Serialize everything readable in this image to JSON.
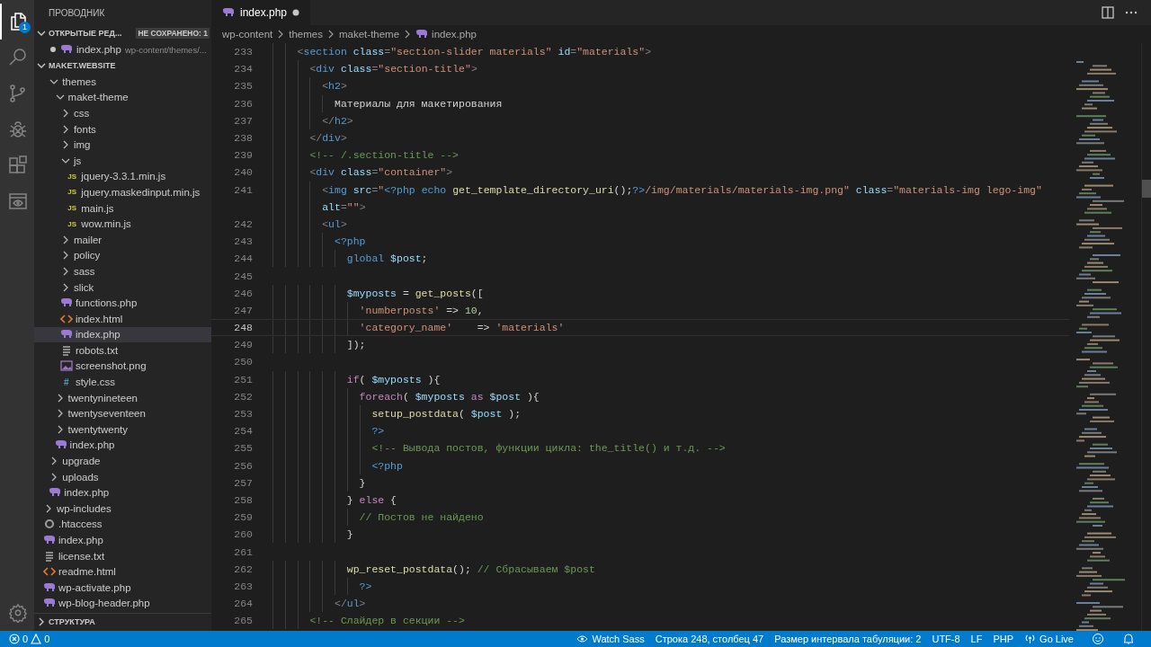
{
  "activity_bar": {
    "items": [
      {
        "kind": "files",
        "selected": true,
        "badge": "1"
      },
      {
        "kind": "search",
        "selected": false
      },
      {
        "kind": "branch",
        "selected": false
      },
      {
        "kind": "bug",
        "selected": false
      },
      {
        "kind": "blocks",
        "selected": false
      },
      {
        "kind": "preview",
        "selected": false
      }
    ],
    "bottom": [
      {
        "kind": "gear"
      }
    ]
  },
  "explorer": {
    "title": "ПРОВОДНИК",
    "open_editors": {
      "title": "ОТКРЫТЫЕ РЕД...",
      "expanded": true,
      "badge": "НЕ СОХРАНЕНО: 1",
      "items": [
        {
          "name": "index.php",
          "kind": "php",
          "description": "wp-content/themes/...",
          "modified": true
        }
      ]
    },
    "root": {
      "title": "MAKET.WEBSITE",
      "expanded": true
    },
    "tree": [
      {
        "kind": "continued",
        "children": [
          {
            "name": "themes",
            "kind": "folder",
            "expanded": true,
            "selected": false,
            "children": [
              {
                "name": "maket-theme",
                "kind": "folder",
                "expanded": true,
                "selected": false,
                "children": [
                  {
                    "name": "css",
                    "kind": "folder",
                    "expanded": false,
                    "selected": false
                  },
                  {
                    "name": "fonts",
                    "kind": "folder",
                    "expanded": false,
                    "selected": false
                  },
                  {
                    "name": "img",
                    "kind": "folder",
                    "expanded": false,
                    "selected": false
                  },
                  {
                    "name": "js",
                    "kind": "folder",
                    "expanded": true,
                    "selected": false,
                    "children": [
                      {
                        "name": "jquery-3.3.1.min.js",
                        "kind": "js",
                        "icon_text": "JS",
                        "selected": false
                      },
                      {
                        "name": "jquery.maskedinput.min.js",
                        "kind": "js",
                        "icon_text": "JS",
                        "selected": false
                      },
                      {
                        "name": "main.js",
                        "kind": "js",
                        "icon_text": "JS",
                        "selected": false
                      },
                      {
                        "name": "wow.min.js",
                        "kind": "js",
                        "icon_text": "JS",
                        "selected": false
                      }
                    ]
                  },
                  {
                    "name": "mailer",
                    "kind": "folder",
                    "expanded": false,
                    "selected": false
                  },
                  {
                    "name": "policy",
                    "kind": "folder",
                    "expanded": false,
                    "selected": false
                  },
                  {
                    "name": "sass",
                    "kind": "folder",
                    "expanded": false,
                    "selected": false
                  },
                  {
                    "name": "slick",
                    "kind": "folder",
                    "expanded": false,
                    "selected": false
                  },
                  {
                    "name": "functions.php",
                    "kind": "php",
                    "selected": false
                  },
                  {
                    "name": "index.html",
                    "kind": "html",
                    "selected": false
                  },
                  {
                    "name": "index.php",
                    "kind": "php",
                    "selected": true
                  },
                  {
                    "name": "robots.txt",
                    "kind": "txt",
                    "selected": false
                  },
                  {
                    "name": "screenshot.png",
                    "kind": "image",
                    "selected": false
                  },
                  {
                    "name": "style.css",
                    "kind": "css",
                    "icon_text": "#",
                    "selected": false
                  }
                ]
              },
              {
                "name": "twentynineteen",
                "kind": "folder",
                "expanded": false,
                "selected": false
              },
              {
                "name": "twentyseventeen",
                "kind": "folder",
                "expanded": false,
                "selected": false
              },
              {
                "name": "twentytwenty",
                "kind": "folder",
                "expanded": false,
                "selected": false
              },
              {
                "name": "index.php",
                "kind": "php",
                "selected": false
              }
            ]
          },
          {
            "name": "upgrade",
            "kind": "folder",
            "expanded": false,
            "selected": false
          },
          {
            "name": "uploads",
            "kind": "folder",
            "expanded": false,
            "selected": false
          },
          {
            "name": "index.php",
            "kind": "php",
            "selected": false
          }
        ]
      },
      {
        "name": "wp-includes",
        "kind": "folder",
        "expanded": false,
        "selected": false
      },
      {
        "name": ".htaccess",
        "kind": "config",
        "selected": false
      },
      {
        "name": "index.php",
        "kind": "php",
        "selected": false
      },
      {
        "name": "license.txt",
        "kind": "txt",
        "selected": false
      },
      {
        "name": "readme.html",
        "kind": "html",
        "selected": false
      },
      {
        "name": "wp-activate.php",
        "kind": "php",
        "selected": false
      },
      {
        "name": "wp-blog-header.php",
        "kind": "php",
        "selected": false
      }
    ],
    "outline": {
      "title": "СТРУКТУРА",
      "expanded": false
    }
  },
  "editor": {
    "tab": {
      "name": "index.php",
      "kind": "php",
      "modified": true
    },
    "breadcrumb": [
      {
        "text": "wp-content"
      },
      {
        "text": "themes"
      },
      {
        "text": "maket-theme"
      },
      {
        "text": "index.php",
        "kind": "php"
      }
    ],
    "lines": [
      {
        "number": "233",
        "current": false,
        "tokens": [
          {
            "kind": "p",
            "text": "    <"
          },
          {
            "kind": "tag",
            "text": "section"
          },
          {
            "kind": "attr",
            "text": " class"
          },
          {
            "kind": "p",
            "text": "="
          },
          {
            "kind": "str",
            "text": "\"section-slider materials\""
          },
          {
            "kind": "attr",
            "text": " id"
          },
          {
            "kind": "p",
            "text": "="
          },
          {
            "kind": "str",
            "text": "\"materials\""
          },
          {
            "kind": "p",
            "text": ">"
          }
        ]
      },
      {
        "number": "234",
        "current": false,
        "tokens": [
          {
            "kind": "p",
            "text": "      <"
          },
          {
            "kind": "tag",
            "text": "div"
          },
          {
            "kind": "attr",
            "text": " class"
          },
          {
            "kind": "p",
            "text": "="
          },
          {
            "kind": "str",
            "text": "\"section-title\""
          },
          {
            "kind": "p",
            "text": ">"
          }
        ]
      },
      {
        "number": "235",
        "current": false,
        "tokens": [
          {
            "kind": "p",
            "text": "        <"
          },
          {
            "kind": "tag",
            "text": "h2"
          },
          {
            "kind": "p",
            "text": ">"
          }
        ]
      },
      {
        "number": "236",
        "current": false,
        "tokens": [
          {
            "kind": "txt",
            "text": "          Материалы для макетирования"
          }
        ]
      },
      {
        "number": "237",
        "current": false,
        "tokens": [
          {
            "kind": "p",
            "text": "        </"
          },
          {
            "kind": "tag",
            "text": "h2"
          },
          {
            "kind": "p",
            "text": ">"
          }
        ]
      },
      {
        "number": "238",
        "current": false,
        "tokens": [
          {
            "kind": "p",
            "text": "      </"
          },
          {
            "kind": "tag",
            "text": "div"
          },
          {
            "kind": "p",
            "text": ">"
          }
        ]
      },
      {
        "number": "239",
        "current": false,
        "tokens": [
          {
            "kind": "cm",
            "text": "      <!-- /.section-title -->"
          }
        ]
      },
      {
        "number": "240",
        "current": false,
        "tokens": [
          {
            "kind": "p",
            "text": "      <"
          },
          {
            "kind": "tag",
            "text": "div"
          },
          {
            "kind": "attr",
            "text": " class"
          },
          {
            "kind": "p",
            "text": "="
          },
          {
            "kind": "str",
            "text": "\"container\""
          },
          {
            "kind": "p",
            "text": ">"
          }
        ]
      },
      {
        "number": "241",
        "current": false,
        "tokens": [
          {
            "kind": "p",
            "text": "        <"
          },
          {
            "kind": "tag",
            "text": "img"
          },
          {
            "kind": "attr",
            "text": " src"
          },
          {
            "kind": "p",
            "text": "="
          },
          {
            "kind": "str",
            "text": "\""
          },
          {
            "kind": "php",
            "text": "<?php"
          },
          {
            "kind": "tag",
            "text": " echo "
          },
          {
            "kind": "fn",
            "text": "get_template_directory_uri"
          },
          {
            "kind": "txt",
            "text": "();"
          },
          {
            "kind": "php",
            "text": "?>"
          },
          {
            "kind": "str",
            "text": "/img/materials/materials-img.png\""
          },
          {
            "kind": "attr",
            "text": " class"
          },
          {
            "kind": "p",
            "text": "="
          },
          {
            "kind": "str",
            "text": "\"materials-img lego-img\""
          }
        ]
      },
      {
        "current": false,
        "tokens": [
          {
            "kind": "attr",
            "text": "        alt"
          },
          {
            "kind": "p",
            "text": "="
          },
          {
            "kind": "str",
            "text": "\"\""
          },
          {
            "kind": "p",
            "text": ">"
          }
        ]
      },
      {
        "number": "242",
        "current": false,
        "tokens": [
          {
            "kind": "p",
            "text": "        <"
          },
          {
            "kind": "tag",
            "text": "ul"
          },
          {
            "kind": "p",
            "text": ">"
          }
        ]
      },
      {
        "number": "243",
        "current": false,
        "tokens": [
          {
            "kind": "php",
            "text": "          <?php"
          }
        ]
      },
      {
        "number": "244",
        "current": false,
        "tokens": [
          {
            "kind": "tag",
            "text": "            global "
          },
          {
            "kind": "var",
            "text": "$post"
          },
          {
            "kind": "txt",
            "text": ";"
          }
        ]
      },
      {
        "number": "245",
        "current": false
      },
      {
        "number": "246",
        "current": false,
        "tokens": [
          {
            "kind": "var",
            "text": "            $myposts"
          },
          {
            "kind": "txt",
            "text": " = "
          },
          {
            "kind": "fn",
            "text": "get_posts"
          },
          {
            "kind": "txt",
            "text": "(["
          }
        ]
      },
      {
        "number": "247",
        "current": false,
        "tokens": [
          {
            "kind": "str",
            "text": "              'numberposts'"
          },
          {
            "kind": "txt",
            "text": " => "
          },
          {
            "kind": "num",
            "text": "10"
          },
          {
            "kind": "txt",
            "text": ","
          }
        ]
      },
      {
        "number": "248",
        "current": true,
        "tokens": [
          {
            "kind": "str",
            "text": "              'category_name'"
          },
          {
            "kind": "txt",
            "text": "    => "
          },
          {
            "kind": "str",
            "text": "'materials'"
          }
        ]
      },
      {
        "number": "249",
        "current": false,
        "tokens": [
          {
            "kind": "txt",
            "text": "            ]);"
          }
        ]
      },
      {
        "number": "250",
        "current": false
      },
      {
        "number": "251",
        "current": false,
        "tokens": [
          {
            "kind": "kw",
            "text": "            if"
          },
          {
            "kind": "txt",
            "text": "( "
          },
          {
            "kind": "var",
            "text": "$myposts"
          },
          {
            "kind": "txt",
            "text": " ){"
          }
        ]
      },
      {
        "number": "252",
        "current": false,
        "tokens": [
          {
            "kind": "kw",
            "text": "              foreach"
          },
          {
            "kind": "txt",
            "text": "( "
          },
          {
            "kind": "var",
            "text": "$myposts"
          },
          {
            "kind": "kw",
            "text": " as "
          },
          {
            "kind": "var",
            "text": "$post"
          },
          {
            "kind": "txt",
            "text": " ){"
          }
        ]
      },
      {
        "number": "253",
        "current": false,
        "tokens": [
          {
            "kind": "fn",
            "text": "                setup_postdata"
          },
          {
            "kind": "txt",
            "text": "( "
          },
          {
            "kind": "var",
            "text": "$post"
          },
          {
            "kind": "txt",
            "text": " );"
          }
        ]
      },
      {
        "number": "254",
        "current": false,
        "tokens": [
          {
            "kind": "php",
            "text": "                ?>"
          }
        ]
      },
      {
        "number": "255",
        "current": false,
        "tokens": [
          {
            "kind": "cm",
            "text": "                <!-- Вывода постов, функции цикла: the_title() и т.д. -->"
          }
        ]
      },
      {
        "number": "256",
        "current": false,
        "tokens": [
          {
            "kind": "php",
            "text": "                <?php"
          }
        ]
      },
      {
        "number": "257",
        "current": false,
        "tokens": [
          {
            "kind": "txt",
            "text": "              }"
          }
        ]
      },
      {
        "number": "258",
        "current": false,
        "tokens": [
          {
            "kind": "txt",
            "text": "            } "
          },
          {
            "kind": "kw",
            "text": "else"
          },
          {
            "kind": "txt",
            "text": " {"
          }
        ]
      },
      {
        "number": "259",
        "current": false,
        "tokens": [
          {
            "kind": "cm",
            "text": "              // Постов не найдено"
          }
        ]
      },
      {
        "number": "260",
        "current": false,
        "tokens": [
          {
            "kind": "txt",
            "text": "            }"
          }
        ]
      },
      {
        "number": "261",
        "current": false
      },
      {
        "number": "262",
        "current": false,
        "tokens": [
          {
            "kind": "fn",
            "text": "            wp_reset_postdata"
          },
          {
            "kind": "txt",
            "text": "(); "
          },
          {
            "kind": "cm",
            "text": "// Сбрасываем $post"
          }
        ]
      },
      {
        "number": "263",
        "current": false,
        "tokens": [
          {
            "kind": "php",
            "text": "              ?>"
          }
        ]
      },
      {
        "number": "264",
        "current": false,
        "tokens": [
          {
            "kind": "p",
            "text": "          </"
          },
          {
            "kind": "tag",
            "text": "ul"
          },
          {
            "kind": "p",
            "text": ">"
          }
        ]
      },
      {
        "number": "265",
        "current": false,
        "tokens": [
          {
            "kind": "cm",
            "text": "      <!-- Слайдер в секции -->"
          }
        ]
      }
    ]
  },
  "status_bar": {
    "errors": "0",
    "warnings": "0",
    "right_items": [
      {
        "kind": "eye",
        "text": "Watch Sass"
      },
      {
        "kind": "plain",
        "text": "Строка 248, столбец 47"
      },
      {
        "kind": "plain",
        "text": "Размер интервала табуляции: 2"
      },
      {
        "kind": "plain",
        "text": "UTF-8"
      },
      {
        "kind": "plain",
        "text": "LF"
      },
      {
        "kind": "plain",
        "text": "PHP"
      },
      {
        "kind": "broadcast",
        "text": "Go Live"
      },
      {
        "kind": "smiley"
      },
      {
        "kind": "bell"
      }
    ]
  }
}
